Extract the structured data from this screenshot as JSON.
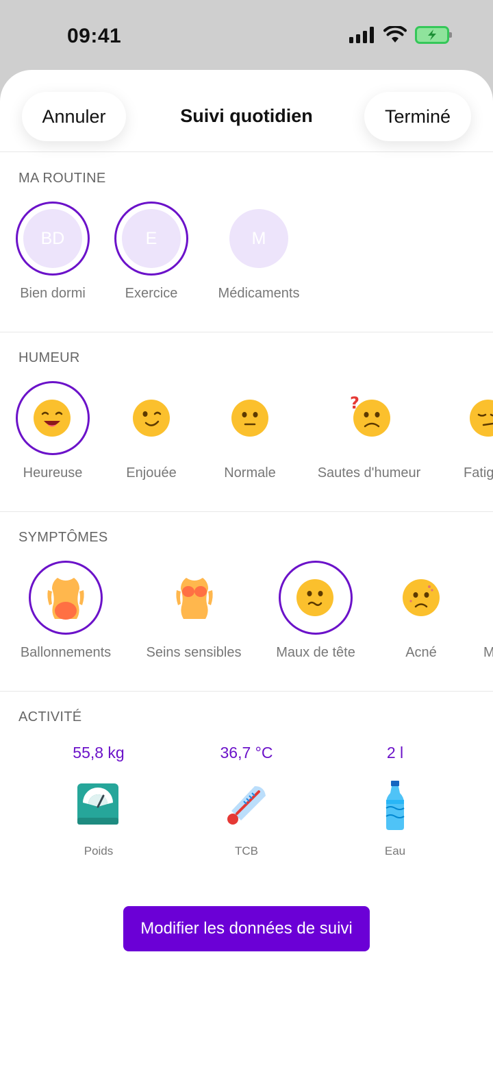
{
  "status_bar": {
    "time": "09:41"
  },
  "header": {
    "cancel_label": "Annuler",
    "title": "Suivi quotidien",
    "done_label": "Terminé"
  },
  "routine": {
    "title": "MA ROUTINE",
    "items": [
      {
        "initials": "BD",
        "label": "Bien dormi",
        "selected": true
      },
      {
        "initials": "E",
        "label": "Exercice",
        "selected": true
      },
      {
        "initials": "M",
        "label": "Médicaments",
        "selected": false
      }
    ]
  },
  "mood": {
    "title": "HUMEUR",
    "items": [
      {
        "icon": "happy-face-icon",
        "label": "Heureuse",
        "selected": true
      },
      {
        "icon": "winking-face-icon",
        "label": "Enjouée",
        "selected": false
      },
      {
        "icon": "neutral-face-icon",
        "label": "Normale",
        "selected": false
      },
      {
        "icon": "confused-face-icon",
        "label": "Sautes d'humeur",
        "selected": false
      },
      {
        "icon": "tired-face-icon",
        "label": "Fatig",
        "selected": false
      }
    ]
  },
  "symptoms": {
    "title": "SYMPTÔMES",
    "items": [
      {
        "icon": "bloated-belly-icon",
        "label": "Ballonnements",
        "selected": true
      },
      {
        "icon": "breast-icon",
        "label": "Seins sensibles",
        "selected": false
      },
      {
        "icon": "headache-face-icon",
        "label": "Maux de tête",
        "selected": true
      },
      {
        "icon": "acne-face-icon",
        "label": "Acné",
        "selected": false
      },
      {
        "icon": "",
        "label": "M",
        "selected": false
      }
    ]
  },
  "activity": {
    "title": "ACTIVITÉ",
    "items": [
      {
        "value": "55,8 kg",
        "icon": "scale-icon",
        "label": "Poids"
      },
      {
        "value": "36,7 °C",
        "icon": "thermometer-icon",
        "label": "TCB"
      },
      {
        "value": "2 l",
        "icon": "water-bottle-icon",
        "label": "Eau"
      }
    ]
  },
  "cta_label": "Modifier les données de suivi",
  "colors": {
    "accent": "#6b12c9",
    "button": "#6b00d6",
    "initial_bg": "#ede4fb",
    "emoji": "#fbc02d"
  }
}
